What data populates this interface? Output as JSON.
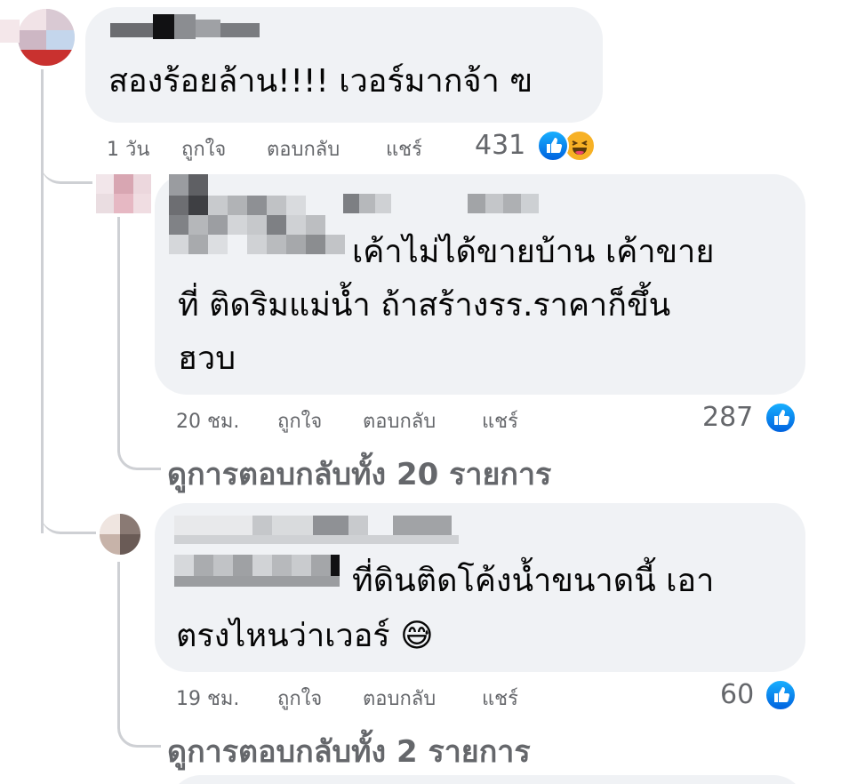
{
  "comments": [
    {
      "text_lines": [
        "สองร้อยล้าน!!!! เวอร์มากจ้า ฃ"
      ],
      "time": "1 วัน",
      "like": "ถูกใจ",
      "reply": "ตอบกลับ",
      "share": "แชร์",
      "reaction_count": "431",
      "reactions": [
        "like-icon",
        "haha-icon"
      ]
    },
    {
      "text_lines": [
        "เค้าไม่ได้ขายบ้าน เค้าขาย",
        "ที่ ติดริมแม่น้ำ ถ้าสร้างรร.ราคาก็ขึ้น",
        "ฮวบ"
      ],
      "time": "20 ชม.",
      "like": "ถูกใจ",
      "reply": "ตอบกลับ",
      "share": "แชร์",
      "reaction_count": "287",
      "reactions": [
        "like-icon"
      ],
      "view_replies": "ดูการตอบกลับทั้ง 20 รายการ"
    },
    {
      "text_lines": [
        "ที่ดินติดโค้งน้ำขนาดนี้ เอา",
        "ตรงไหนว่าเวอร์ 😅"
      ],
      "time": "19 ชม.",
      "like": "ถูกใจ",
      "reply": "ตอบกลับ",
      "share": "แชร์",
      "reaction_count": "60",
      "reactions": [
        "like-icon"
      ],
      "view_replies": "ดูการตอบกลับทั้ง 2 รายการ"
    }
  ],
  "colors": {
    "bubble": "#f0f2f5",
    "meta_text": "#65676b",
    "like_blue": "#1877f2",
    "thread_line": "#ced0d4"
  }
}
